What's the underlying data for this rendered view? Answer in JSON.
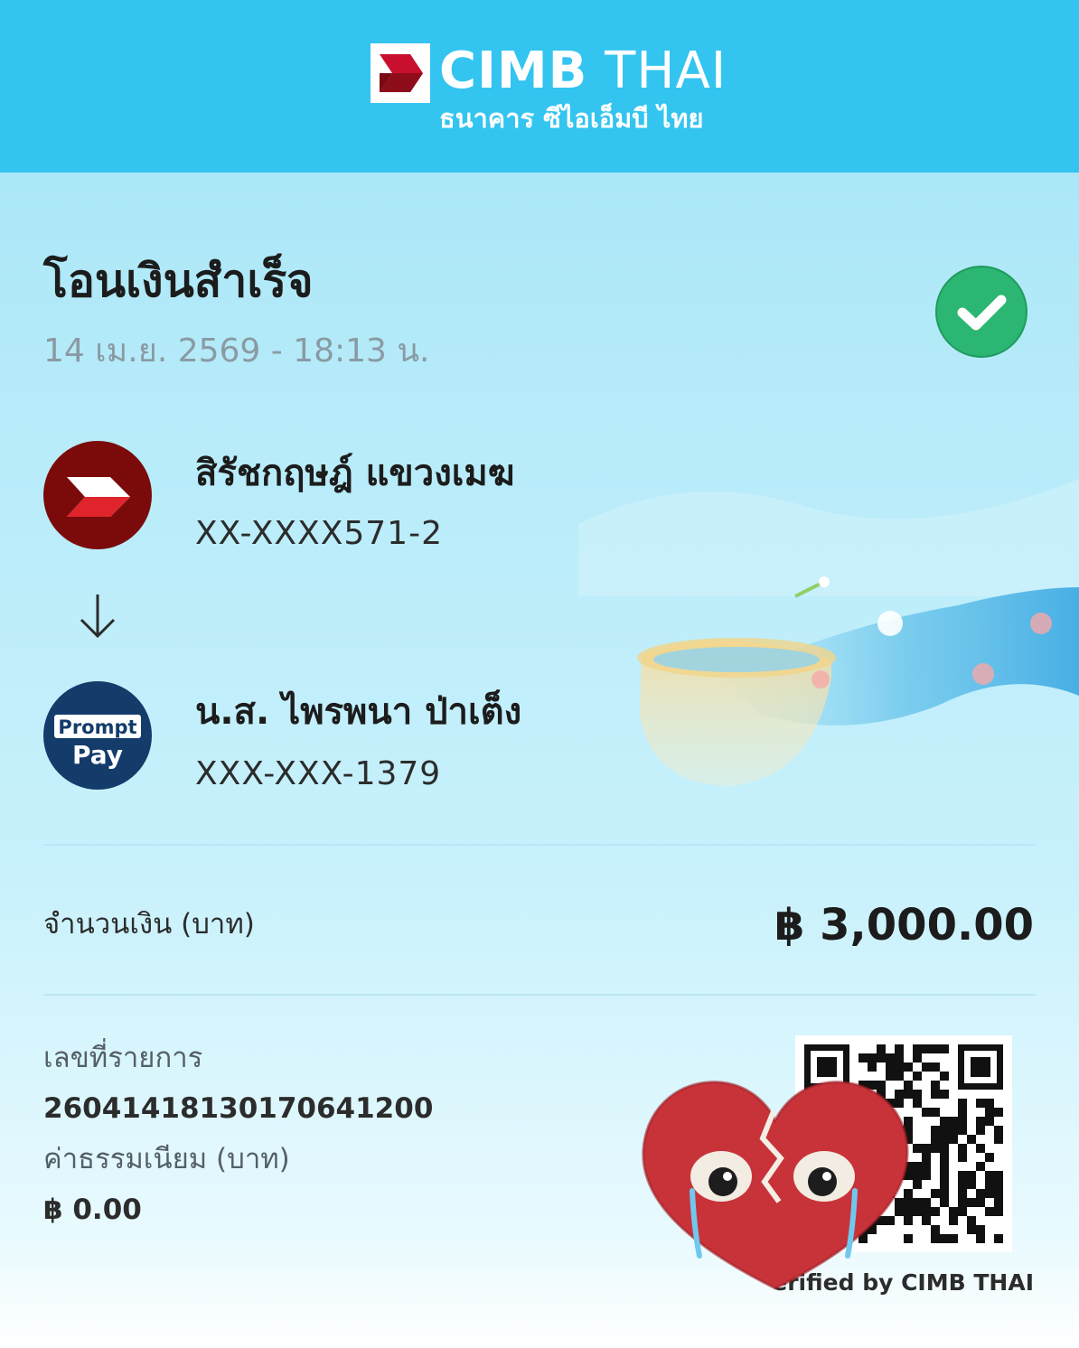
{
  "header": {
    "logo_text_bold": "CIMB",
    "logo_text_light": "THAI",
    "logo_subtitle": "ธนาคาร ซีไอเอ็มบี ไทย",
    "background_color": "#33c4f0",
    "logo_icon": "cimb-chevron-icon"
  },
  "status": {
    "title": "โอนเงินสำเร็จ",
    "datetime": "14 เม.ย. 2569 - 18:13 น.",
    "icon": "check-circle-icon",
    "icon_color": "#2bb673"
  },
  "sender": {
    "name": "สิรัชกฤษฎ์ แขวงเมฆ",
    "account": "XX-XXXX571-2",
    "icon": "cimb-logo-icon",
    "icon_color": "#7b0b0b"
  },
  "transfer_arrow_icon": "arrow-down-icon",
  "receiver": {
    "name": "น.ส. ไพรพนา ป่าเต็ง",
    "account": "XXX-XXX-1379",
    "icon": "promptpay-logo-icon",
    "icon_text_top": "Prompt",
    "icon_text_bottom": "Pay",
    "icon_color": "#143c6b"
  },
  "amount": {
    "label": "จำนวนเงิน (บาท)",
    "value": "฿ 3,000.00"
  },
  "details": {
    "ref_label": "เลขที่รายการ",
    "ref_value": "2604141813017064120​0",
    "fee_label": "ค่าธรรมเนียม (บาท)",
    "fee_value": "฿ 0.00"
  },
  "verification": {
    "qr_icon": "qr-code-icon",
    "text": "erified by CIMB THAI"
  },
  "sticker_icon": "crying-broken-heart-icon"
}
